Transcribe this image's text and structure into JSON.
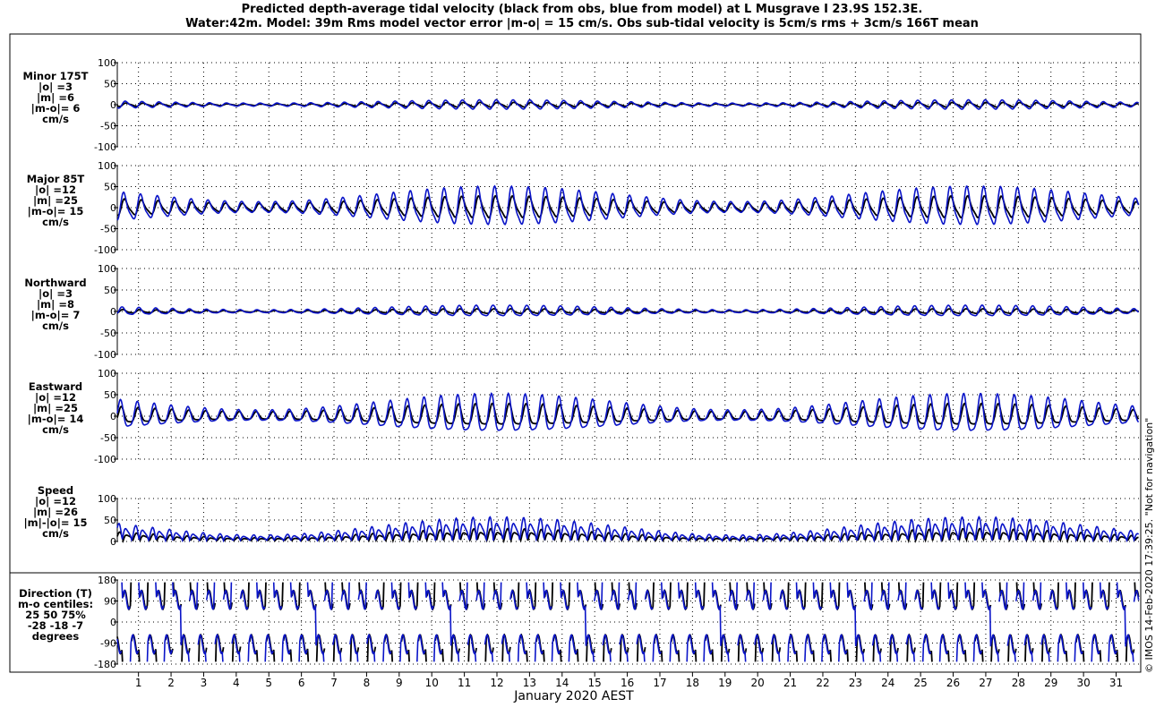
{
  "title": {
    "line1": "Predicted depth-average tidal velocity (black from obs, blue from model) at L Musgrave I 23.9S 152.3E.",
    "line2": "Water:42m. Model: 39m  Rms model vector error |m-o| = 15 cm/s. Obs sub-tidal velocity is 5cm/s rms + 3cm/s 166T mean"
  },
  "xlabel": "January 2020 AEST",
  "credit": "© IMOS 14-Feb-2020 17:39:25. \"Not for navigation\"",
  "colors": {
    "obs": "#000000",
    "model": "#0a14c8"
  },
  "chart_data": [
    {
      "type": "line",
      "panel": "minor",
      "label_lines": [
        "Minor 175T",
        "|o| =3",
        "|m| =6",
        "|m-o|= 6",
        "cm/s"
      ],
      "ylim": [
        -100,
        100
      ],
      "y_ticks": [
        "100",
        "50",
        "0",
        "-50",
        "-100"
      ],
      "grid": true,
      "series": [
        {
          "key": "obs",
          "amplitude": [
            2,
            6
          ],
          "mean": 0
        },
        {
          "key": "model",
          "amplitude": [
            4,
            12
          ],
          "mean": 0
        }
      ]
    },
    {
      "type": "line",
      "panel": "major",
      "label_lines": [
        "Major 85T",
        "|o| =12",
        "|m| =25",
        "|m-o|= 15",
        "cm/s"
      ],
      "ylim": [
        -100,
        100
      ],
      "y_ticks": [
        "100",
        "50",
        "0",
        "-50",
        "-100"
      ],
      "grid": true,
      "series": [
        {
          "key": "obs",
          "amplitude": [
            10,
            28
          ],
          "mean": 0
        },
        {
          "key": "model",
          "amplitude": [
            14,
            50
          ],
          "mean": 0
        }
      ]
    },
    {
      "type": "line",
      "panel": "northward",
      "label_lines": [
        "Northward",
        "|o| =3",
        "|m| =8",
        "|m-o|= 7",
        "cm/s"
      ],
      "ylim": [
        -100,
        100
      ],
      "y_ticks": [
        "100",
        "50",
        "0",
        "-50",
        "-100"
      ],
      "grid": true,
      "series": [
        {
          "key": "obs",
          "amplitude": [
            2,
            6
          ],
          "mean": 0
        },
        {
          "key": "model",
          "amplitude": [
            4,
            14
          ],
          "mean": 0
        }
      ]
    },
    {
      "type": "line",
      "panel": "eastward",
      "label_lines": [
        "Eastward",
        "|o| =12",
        "|m| =25",
        "|m-o|= 14",
        "cm/s"
      ],
      "ylim": [
        -100,
        100
      ],
      "y_ticks": [
        "100",
        "50",
        "0",
        "-50",
        "-100"
      ],
      "grid": true,
      "series": [
        {
          "key": "obs",
          "amplitude": [
            10,
            28
          ],
          "mean": 0
        },
        {
          "key": "model",
          "amplitude": [
            14,
            50
          ],
          "mean": 0
        }
      ]
    },
    {
      "type": "line",
      "panel": "speed",
      "label_lines": [
        "Speed",
        "|o| =12",
        "|m| =26",
        "|m|-|o|= 15",
        "cm/s"
      ],
      "ylim": [
        0,
        100
      ],
      "y_ticks": [
        "100",
        "50",
        "0"
      ],
      "grid": true,
      "series": [
        {
          "key": "obs",
          "amplitude": [
            6,
            25
          ],
          "mean": 0
        },
        {
          "key": "model",
          "amplitude": [
            12,
            50
          ],
          "mean": 0
        }
      ]
    },
    {
      "type": "line",
      "panel": "direction",
      "label_lines": [
        "Direction (T)",
        "m-o centiles:",
        "25  50  75%",
        "-28 -18  -7",
        "degrees"
      ],
      "ylim": [
        -180,
        180
      ],
      "y_ticks": [
        "180",
        "90",
        "0",
        "-90",
        "-180"
      ],
      "grid": true,
      "series": [
        {
          "key": "obs",
          "amplitude": [
            180,
            180
          ],
          "mean": 0
        },
        {
          "key": "model",
          "amplitude": [
            180,
            180
          ],
          "mean": 0
        }
      ]
    }
  ],
  "x_axis": {
    "unit": "day of January 2020",
    "xlim": [
      0.35,
      31.7
    ],
    "tick_labels": [
      "1",
      "2",
      "3",
      "4",
      "5",
      "6",
      "7",
      "8",
      "9",
      "10",
      "11",
      "12",
      "13",
      "14",
      "15",
      "16",
      "17",
      "18",
      "19",
      "20",
      "21",
      "22",
      "23",
      "24",
      "25",
      "26",
      "27",
      "28",
      "29",
      "30",
      "31"
    ]
  }
}
